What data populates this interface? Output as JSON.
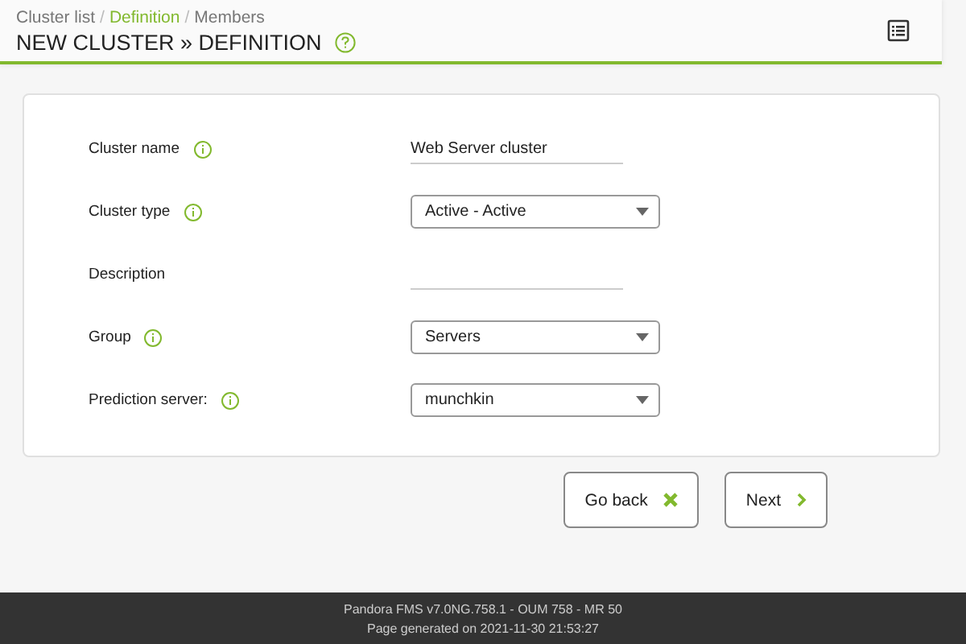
{
  "breadcrumb": {
    "separator": "/",
    "items": [
      {
        "label": "Cluster list",
        "selected": false
      },
      {
        "label": "Definition",
        "selected": true
      },
      {
        "label": "Members",
        "selected": false
      }
    ]
  },
  "header": {
    "title": "NEW CLUSTER » DEFINITION"
  },
  "form": {
    "fields": [
      {
        "label": "Cluster name",
        "help": true,
        "kind": "text",
        "value": "Web Server cluster"
      },
      {
        "label": "Cluster type",
        "help": true,
        "kind": "select",
        "value": "Active - Active"
      },
      {
        "label": "Description",
        "help": false,
        "kind": "text"
      },
      {
        "label": "Group",
        "help": true,
        "kind": "select",
        "value": "Servers"
      },
      {
        "label": "Prediction server:",
        "help": true,
        "kind": "select",
        "value": "munchkin"
      }
    ]
  },
  "buttons": [
    {
      "label": "Go back",
      "kind": "cancel"
    },
    {
      "label": "Next",
      "kind": "next"
    }
  ],
  "footer": {
    "lines": [
      "Pandora FMS v7.0NG.758.1 - OUM 758 - MR 50",
      "Page generated on 2021-11-30 21:53:27"
    ]
  }
}
